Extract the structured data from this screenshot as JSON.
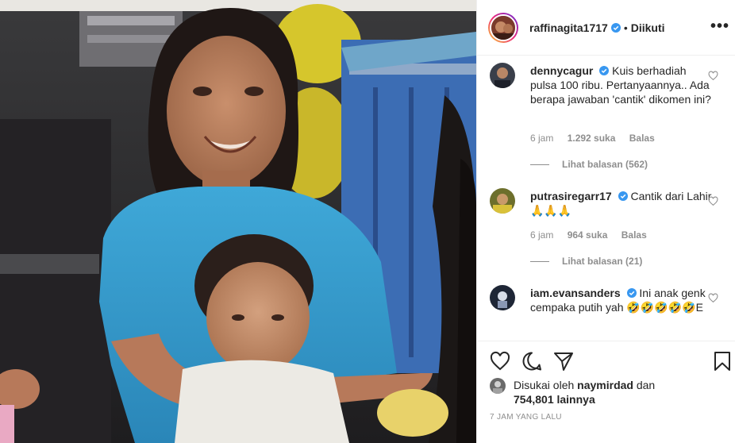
{
  "post": {
    "author": "raffinagita1717",
    "separator": "•",
    "follow_status": "Diikuti",
    "more_label": "•••"
  },
  "comments": [
    {
      "user": "dennycagur",
      "verified": true,
      "text": "Kuis berhadiah pulsa 100 ribu. Pertanyaannya.. Ada berapa jawaban 'cantik' dikomen ini?",
      "time": "6 jam",
      "likes": "1.292 suka",
      "reply": "Balas",
      "view_replies": "Lihat balasan (562)"
    },
    {
      "user": "putrasiregarr17",
      "verified": true,
      "text": "Cantik dari Lahir 🙏🙏🙏",
      "time": "6 jam",
      "likes": "964 suka",
      "reply": "Balas",
      "view_replies": "Lihat balasan (21)"
    },
    {
      "user": "iam.evansanders",
      "verified": true,
      "text": "Ini anak genk cempaka putih yah 🤣🤣🤣🤣🤣E"
    }
  ],
  "actions": {
    "like_icon": "heart-icon",
    "comment_icon": "comment-icon",
    "share_icon": "paper-plane-icon",
    "save_icon": "bookmark-icon"
  },
  "likes_summary": {
    "prefix": "Disukai oleh",
    "user": "naymirdad",
    "conjunction": "dan",
    "others": "754,801 lainnya"
  },
  "timestamp": "7 JAM YANG LALU",
  "colors": {
    "verified": "#3897f0",
    "text": "#262626",
    "muted": "#8e8e8e",
    "border": "#efefef"
  }
}
